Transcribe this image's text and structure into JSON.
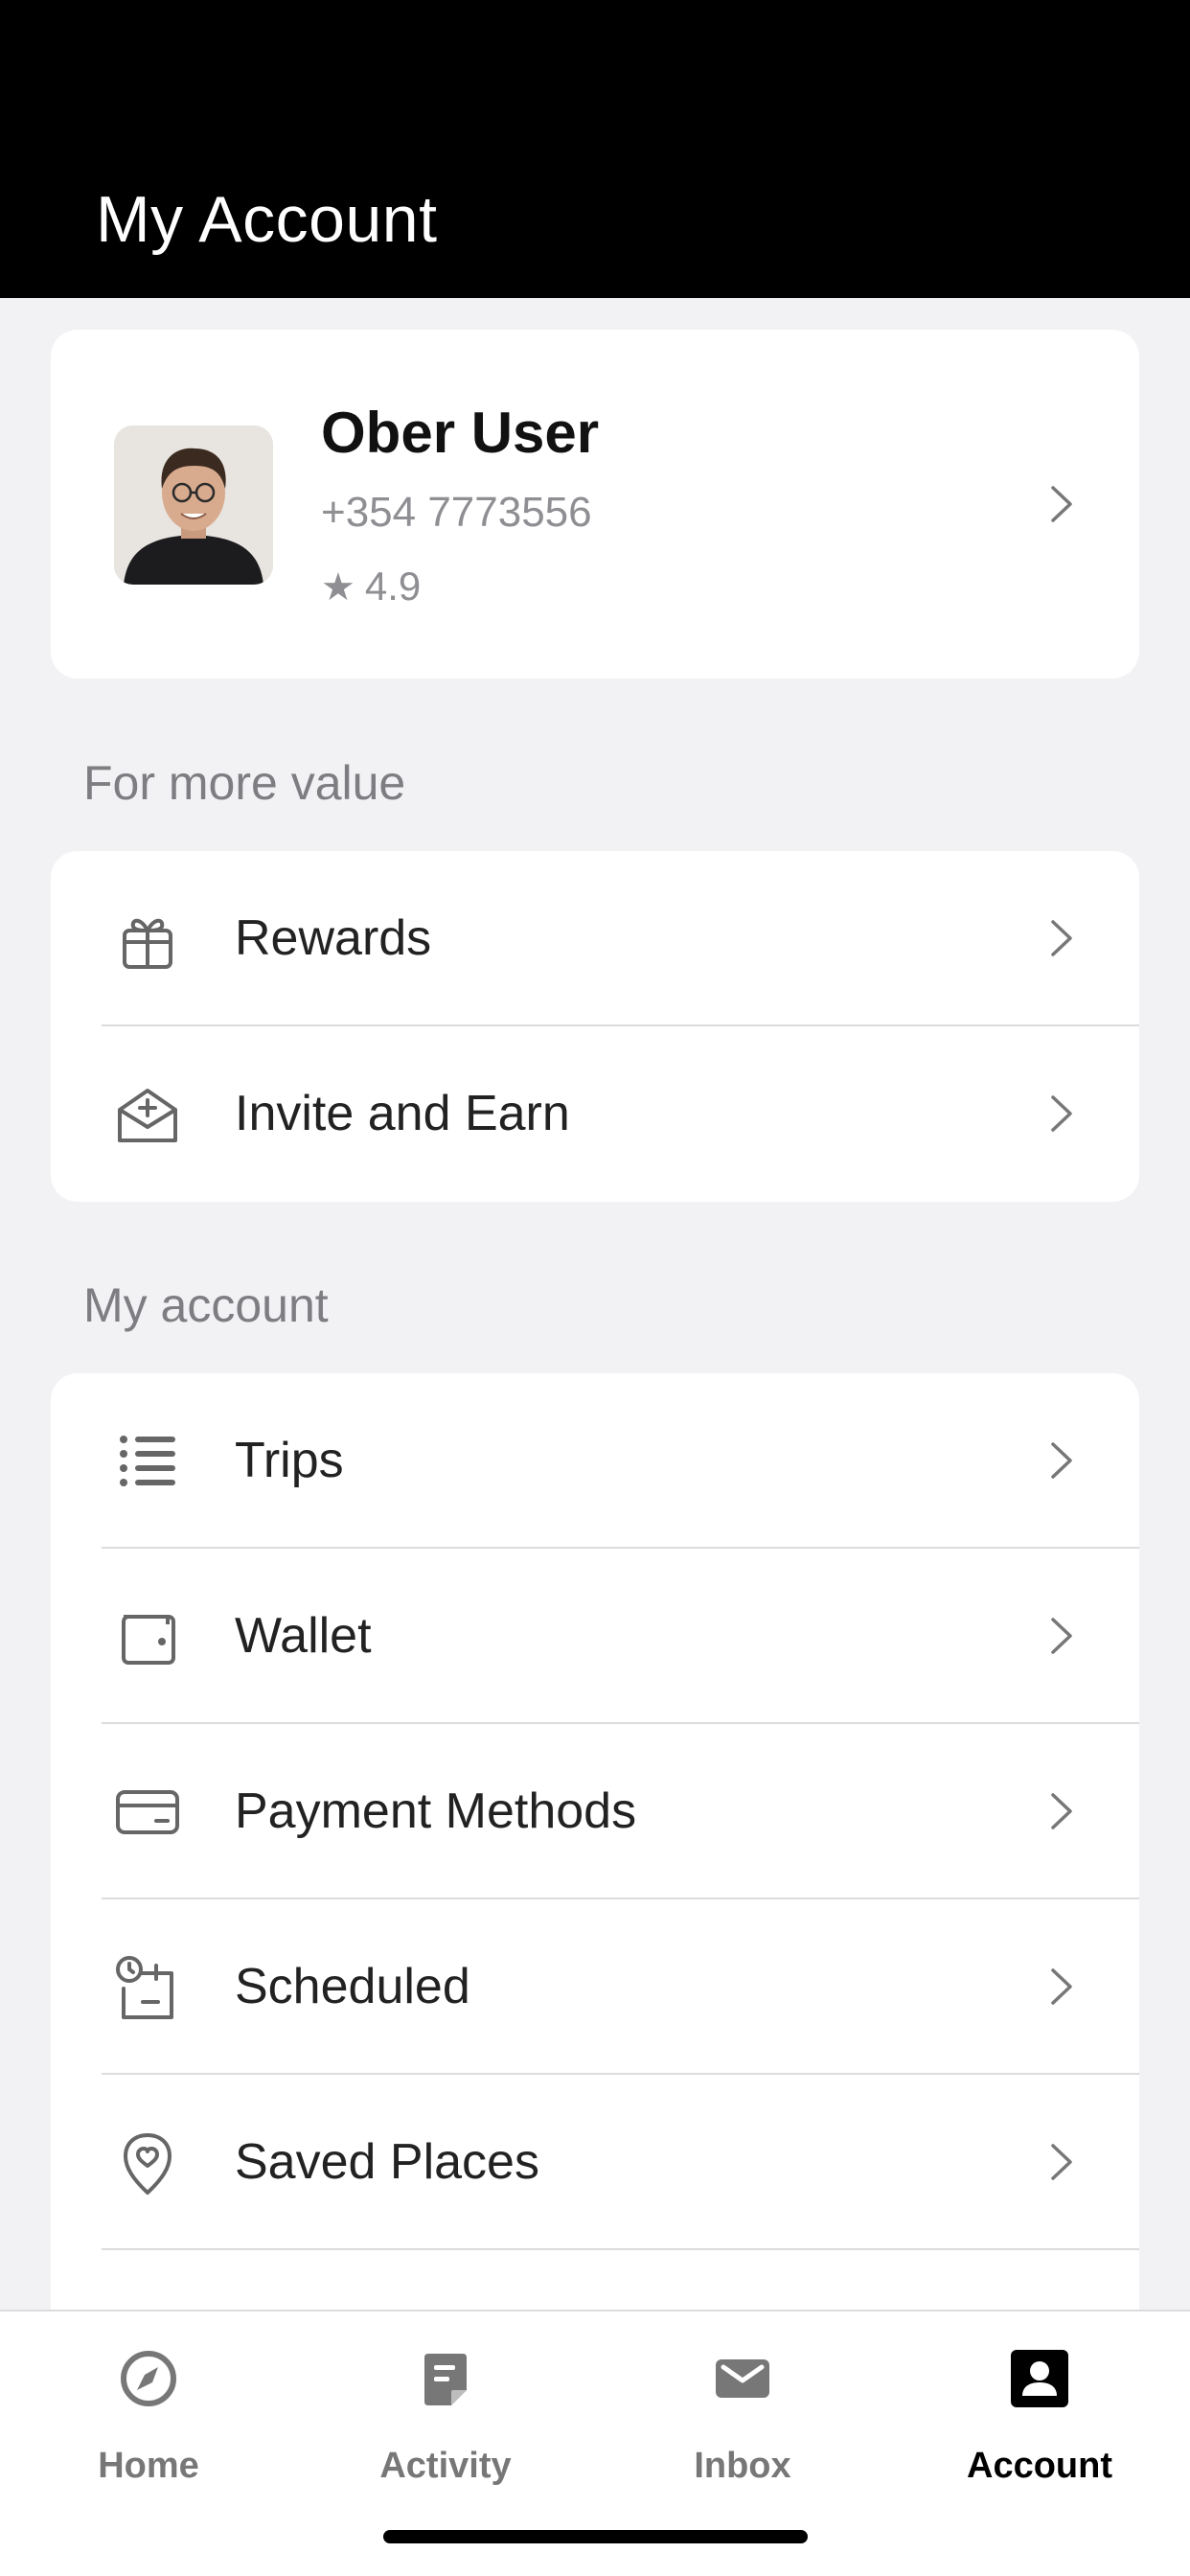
{
  "header": {
    "title": "My Account"
  },
  "profile": {
    "name": "Ober User",
    "phone": "+354 7773556",
    "rating_star": "★",
    "rating": "4.9"
  },
  "sections": {
    "more_value": {
      "label": "For more value",
      "items": [
        {
          "label": "Rewards",
          "icon": "gift-icon"
        },
        {
          "label": "Invite and Earn",
          "icon": "mail-plus-icon"
        }
      ]
    },
    "my_account": {
      "label": "My account",
      "items": [
        {
          "label": "Trips",
          "icon": "list-icon"
        },
        {
          "label": "Wallet",
          "icon": "wallet-icon"
        },
        {
          "label": "Payment Methods",
          "icon": "credit-card-icon"
        },
        {
          "label": "Scheduled",
          "icon": "clock-calendar-icon"
        },
        {
          "label": "Saved Places",
          "icon": "heart-pin-icon"
        }
      ]
    }
  },
  "tabbar": {
    "tabs": [
      {
        "label": "Home",
        "icon": "compass-icon",
        "active": false
      },
      {
        "label": "Activity",
        "icon": "receipt-icon",
        "active": false
      },
      {
        "label": "Inbox",
        "icon": "mail-icon",
        "active": false
      },
      {
        "label": "Account",
        "icon": "account-icon",
        "active": true
      }
    ]
  },
  "colors": {
    "header_bg": "#000000",
    "page_bg": "#f2f2f5",
    "card_bg": "#ffffff",
    "muted_text": "#8e8e93",
    "active_tab": "#000000"
  }
}
